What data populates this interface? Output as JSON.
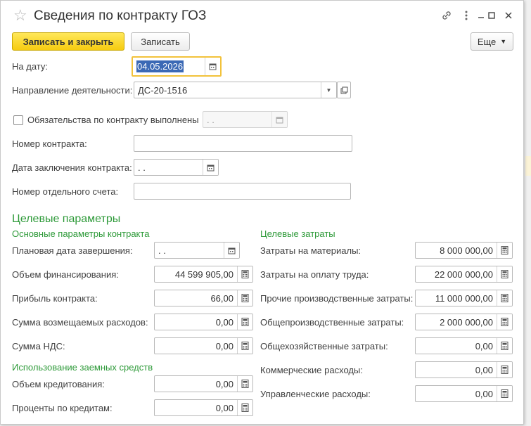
{
  "window": {
    "title": "Сведения по контракту ГОЗ"
  },
  "toolbar": {
    "save_close_label": "Записать и закрыть",
    "save_label": "Записать",
    "more_label": "Еще"
  },
  "header_fields": {
    "date_label": "На дату:",
    "date_value": "04.05.2026",
    "direction_label": "Направление деятельности:",
    "direction_value": "ДС-20-1516",
    "obligations_label": "Обязательства по контракту выполнены",
    "obligations_checked": false,
    "obligations_date_value": " .  .",
    "contract_number_label": "Номер контракта:",
    "contract_number_value": "",
    "contract_date_label": "Дата заключения контракта:",
    "contract_date_value": " .  .",
    "account_label": "Номер отдельного счета:",
    "account_value": ""
  },
  "target": {
    "section_title": "Целевые параметры",
    "main_group_title": "Основные параметры контракта",
    "main": [
      {
        "label": "Плановая дата завершения:",
        "value": " .  .",
        "kind": "date"
      },
      {
        "label": "Объем финансирования:",
        "value": "44 599 905,00",
        "kind": "number"
      },
      {
        "label": "Прибыль контракта:",
        "value": "66,00",
        "kind": "number"
      },
      {
        "label": "Сумма возмещаемых расходов:",
        "value": "0,00",
        "kind": "number"
      },
      {
        "label": "Сумма НДС:",
        "value": "0,00",
        "kind": "number"
      }
    ],
    "credit_group_title": "Использование заемных средств",
    "credit": [
      {
        "label": "Объем кредитования:",
        "value": "0,00",
        "kind": "number"
      },
      {
        "label": "Проценты по кредитам:",
        "value": "0,00",
        "kind": "number"
      }
    ],
    "costs_group_title": "Целевые затраты",
    "costs": [
      {
        "label": "Затраты на материалы:",
        "value": "8 000 000,00"
      },
      {
        "label": "Затраты на оплату труда:",
        "value": "22 000 000,00"
      },
      {
        "label": "Прочие производственные затраты:",
        "value": "11 000 000,00"
      },
      {
        "label": "Общепроизводственные затраты:",
        "value": "2 000 000,00"
      },
      {
        "label": "Общехозяйственные затраты:",
        "value": "0,00"
      },
      {
        "label": "Коммерческие расходы:",
        "value": "0,00"
      },
      {
        "label": "Управленческие расходы:",
        "value": "0,00"
      }
    ]
  },
  "icons": {
    "star": "star-icon",
    "link": "link-icon",
    "more": "more-icon",
    "minimize": "minimize-icon",
    "maximize": "maximize-icon",
    "close": "close-icon",
    "calendar": "calendar-icon",
    "calculator": "calculator-icon",
    "dropdown": "dropdown-icon",
    "open": "open-icon"
  },
  "colors": {
    "primary_button": "#f6cb10",
    "section_green": "#2e9a39",
    "focus_border": "#f2c23b",
    "selection": "#3b69b5"
  }
}
